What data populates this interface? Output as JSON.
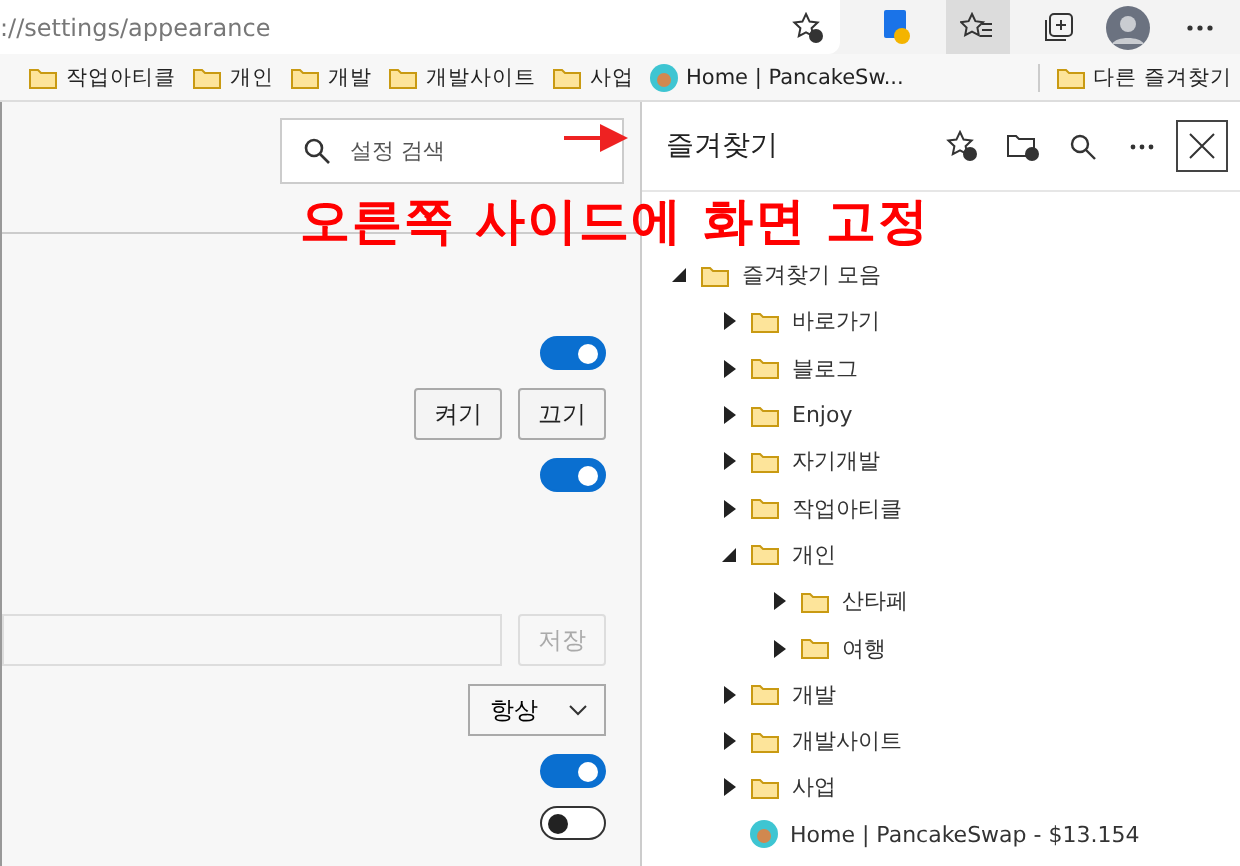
{
  "address_bar": {
    "url": "://settings/appearance"
  },
  "bookmarks_bar": {
    "items": [
      {
        "label": "작업아티클",
        "kind": "folder"
      },
      {
        "label": "개인",
        "kind": "folder"
      },
      {
        "label": "개발",
        "kind": "folder"
      },
      {
        "label": "개발사이트",
        "kind": "folder"
      },
      {
        "label": "사업",
        "kind": "folder"
      },
      {
        "label": "Home | PancakeSw...",
        "kind": "site"
      }
    ],
    "other_favorites": "다른 즐겨찾기"
  },
  "settings": {
    "search": {
      "placeholder": "설정 검색"
    },
    "rows": [
      {
        "kind": "toggle",
        "on": true
      },
      {
        "kind": "buttons",
        "buttons": [
          "켜기",
          "끄기"
        ]
      },
      {
        "kind": "toggle",
        "on": true
      },
      {
        "kind": "input",
        "button": "저장",
        "disabled": true
      },
      {
        "kind": "select",
        "value": "항상"
      },
      {
        "kind": "toggle",
        "on": true
      },
      {
        "kind": "toggle",
        "on": false
      }
    ]
  },
  "favorites": {
    "title": "즐겨찾기",
    "items": [
      {
        "label": "즐겨찾기 모음",
        "kind": "folder",
        "expanded": true,
        "children": [
          {
            "label": "바로가기",
            "kind": "folder",
            "expanded": false
          },
          {
            "label": "블로그",
            "kind": "folder",
            "expanded": false
          },
          {
            "label": "Enjoy",
            "kind": "folder",
            "expanded": false
          },
          {
            "label": "자기개발",
            "kind": "folder",
            "expanded": false
          },
          {
            "label": "작업아티클",
            "kind": "folder",
            "expanded": false
          },
          {
            "label": "개인",
            "kind": "folder",
            "expanded": true,
            "children": [
              {
                "label": "산타페",
                "kind": "folder",
                "expanded": false
              },
              {
                "label": "여행",
                "kind": "folder",
                "expanded": false
              }
            ]
          },
          {
            "label": "개발",
            "kind": "folder",
            "expanded": false
          },
          {
            "label": "개발사이트",
            "kind": "folder",
            "expanded": false
          },
          {
            "label": "사업",
            "kind": "folder",
            "expanded": false
          },
          {
            "label": "Home | PancakeSwap - $13.154",
            "kind": "site"
          }
        ]
      }
    ]
  },
  "annotation": {
    "text": "오른쪽 사이드에 화면 고정"
  }
}
